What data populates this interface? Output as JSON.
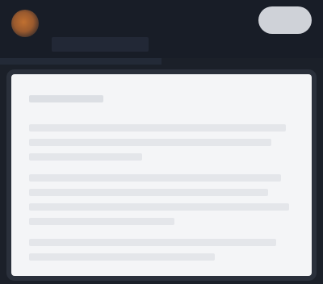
{
  "header": {
    "logo": "logo-icon",
    "title": "",
    "nav_tab": "",
    "action_button_label": ""
  },
  "content": {
    "heading": "",
    "lines": [
      "",
      "",
      "",
      "",
      "",
      "",
      "",
      "",
      ""
    ]
  },
  "colors": {
    "topbar_bg": "#181d27",
    "page_bg": "#1b2029",
    "card_bg": "#f4f5f7",
    "accent_logo": "#b86a30",
    "button_bg": "#cfd2d8"
  }
}
